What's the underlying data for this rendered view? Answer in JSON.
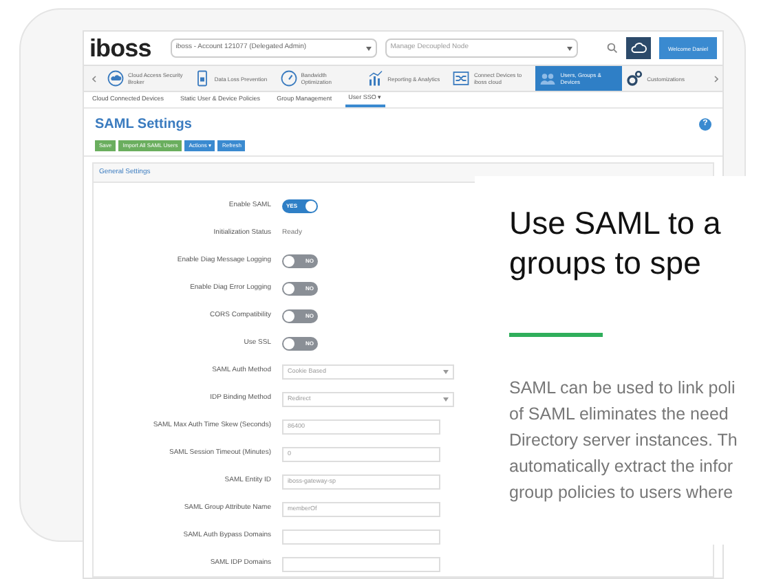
{
  "header": {
    "logo": "iboss",
    "account_select": "iboss - Account 121077 (Delegated Admin)",
    "node_select": "Manage Decoupled Node",
    "welcome_button": "Welcome Daniel"
  },
  "nav": [
    {
      "label": "Cloud Access Security Broker",
      "selected": false
    },
    {
      "label": "Data Loss Prevention",
      "selected": false
    },
    {
      "label": "Bandwidth Optimization",
      "selected": false
    },
    {
      "label": "Reporting & Analytics",
      "selected": false
    },
    {
      "label": "Connect Devices to iboss cloud",
      "selected": false
    },
    {
      "label": "Users, Groups & Devices",
      "selected": true
    },
    {
      "label": "Customizations",
      "selected": false
    }
  ],
  "subtabs": [
    {
      "label": "Cloud Connected Devices",
      "selected": false
    },
    {
      "label": "Static User & Device Policies",
      "selected": false
    },
    {
      "label": "Group Management",
      "selected": false
    },
    {
      "label": "User SSO ▾",
      "selected": true
    }
  ],
  "title": "SAML Settings",
  "help_button": "?",
  "toolbar": [
    {
      "label": "Save",
      "kind": "green"
    },
    {
      "label": "Import All SAML Users",
      "kind": "green"
    },
    {
      "label": "Actions ▾",
      "kind": "blue"
    },
    {
      "label": "Refresh",
      "kind": "blue"
    }
  ],
  "section_title": "General Settings",
  "fields": [
    {
      "label": "Enable SAML",
      "kind": "toggle",
      "on": true,
      "value": "YES"
    },
    {
      "label": "Initialization Status",
      "kind": "text",
      "value": "Ready"
    },
    {
      "label": "Enable Diag Message Logging",
      "kind": "toggle",
      "on": false,
      "value": "NO"
    },
    {
      "label": "Enable Diag Error Logging",
      "kind": "toggle",
      "on": false,
      "value": "NO"
    },
    {
      "label": "CORS Compatibility",
      "kind": "toggle",
      "on": false,
      "value": "NO"
    },
    {
      "label": "Use SSL",
      "kind": "toggle",
      "on": false,
      "value": "NO"
    },
    {
      "label": "SAML Auth Method",
      "kind": "select",
      "value": "Cookie Based"
    },
    {
      "label": "IDP Binding Method",
      "kind": "select",
      "value": "Redirect"
    },
    {
      "label": "SAML Max Auth Time Skew (Seconds)",
      "kind": "input",
      "value": "86400"
    },
    {
      "label": "SAML Session Timeout (Minutes)",
      "kind": "input",
      "value": "0"
    },
    {
      "label": "SAML Entity ID",
      "kind": "input",
      "value": "iboss-gateway-sp"
    },
    {
      "label": "SAML Group Attribute Name",
      "kind": "input",
      "value": "memberOf"
    },
    {
      "label": "SAML Auth Bypass Domains",
      "kind": "input"
    },
    {
      "label": "SAML IDP Domains",
      "kind": "input"
    }
  ],
  "marketing": {
    "heading_lines": [
      "Use SAML to a",
      "groups to spe"
    ],
    "paragraph_lines": [
      "SAML can be used to link poli",
      "of SAML eliminates the need",
      "Directory server instances. Th",
      "automatically extract the infor",
      "group policies to users where"
    ]
  }
}
